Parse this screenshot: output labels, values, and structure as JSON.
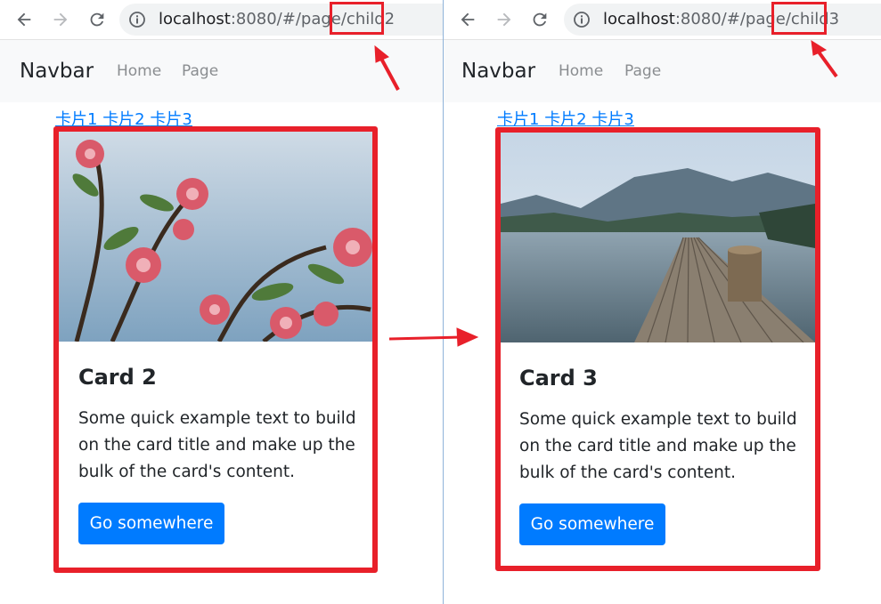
{
  "browser": {
    "back_icon": "arrow-left-icon",
    "forward_icon": "arrow-right-icon",
    "reload_icon": "reload-icon",
    "info_icon": "info-icon"
  },
  "left": {
    "url_host": "localhost",
    "url_rest": ":8080/#/page/",
    "url_highlight": "child2",
    "navbar": {
      "brand": "Navbar",
      "links": [
        "Home",
        "Page"
      ]
    },
    "card_links": [
      "卡片1",
      "卡片2",
      "卡片3"
    ],
    "card": {
      "title": "Card 2",
      "text": "Some quick example text to build on the card title and make up the bulk of the card's content.",
      "button": "Go somewhere",
      "image": "pink-flowers-photo"
    }
  },
  "right": {
    "url_host": "localhost",
    "url_rest": ":8080/#/page/",
    "url_highlight": "child3",
    "navbar": {
      "brand": "Navbar",
      "links": [
        "Home",
        "Page"
      ]
    },
    "card_links": [
      "卡片1",
      "卡片2",
      "卡片3"
    ],
    "card": {
      "title": "Card 3",
      "text": "Some quick example text to build on the card title and make up the bulk of the card's content.",
      "button": "Go somewhere",
      "image": "lake-pier-photo"
    }
  },
  "colors": {
    "annotation_red": "#e8202a",
    "primary": "#007bff",
    "navbar_bg": "#f8f9fa"
  }
}
